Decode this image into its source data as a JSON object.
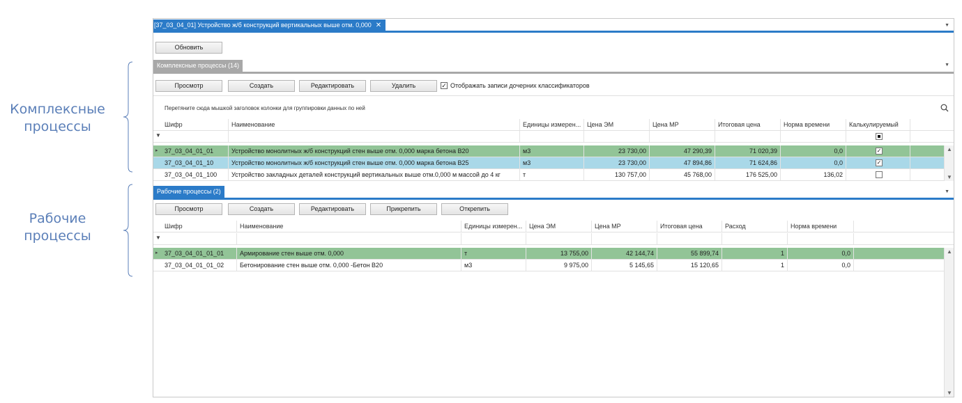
{
  "annotations": {
    "complex_line1": "Комплексные",
    "complex_line2": "процессы",
    "work_line1": "Рабочие",
    "work_line2": "процессы"
  },
  "doc_tab": {
    "title": "[37_03_04_01] Устройство ж/б конструкций вертикальных выше отм. 0,000",
    "close": "✕"
  },
  "refresh_button": "Обновить",
  "complex": {
    "tab_label": "Комплексные процессы (14)",
    "buttons": {
      "view": "Просмотр",
      "create": "Создать",
      "edit": "Редактировать",
      "delete": "Удалить"
    },
    "show_child_label": "Отображать записи дочерних классификаторов",
    "show_child_checked": "✓",
    "group_hint": "Перетяните сюда мышкой заголовок колонки для группировки данных по ней",
    "columns": [
      "Шифр",
      "Наименование",
      "Единицы измерен...",
      "Цена ЭМ",
      "Цена МР",
      "Итоговая цена",
      "Норма времени",
      "Калькулируемый"
    ],
    "rows": [
      {
        "code": "37_03_04_01_01",
        "name": "Устройство монолитных ж/б конструкций стен выше отм. 0,000 марка бетона В20",
        "unit": "м3",
        "em": "23 730,00",
        "mr": "47 290,39",
        "total": "71 020,39",
        "norm": "0,0",
        "calc": "✓"
      },
      {
        "code": "37_03_04_01_10",
        "name": "Устройство монолитных ж/б конструкций стен выше отм. 0,000 марка бетона В25",
        "unit": "м3",
        "em": "23 730,00",
        "mr": "47 894,86",
        "total": "71 624,86",
        "norm": "0,0",
        "calc": "✓"
      },
      {
        "code": "37_03_04_01_100",
        "name": "Устройство закладных деталей конструкций вертикальных выше отм.0,000 м массой до 4 кг",
        "unit": "т",
        "em": "130 757,00",
        "mr": "45 768,00",
        "total": "176 525,00",
        "norm": "136,02",
        "calc": ""
      }
    ]
  },
  "work": {
    "tab_label": "Рабочие процессы (2)",
    "buttons": {
      "view": "Просмотр",
      "create": "Создать",
      "edit": "Редактировать",
      "attach": "Прикрепить",
      "detach": "Открепить"
    },
    "columns": [
      "Шифр",
      "Наименование",
      "Единицы измерен...",
      "Цена ЭМ",
      "Цена МР",
      "Итоговая цена",
      "Расход",
      "Норма времени"
    ],
    "rows": [
      {
        "code": "37_03_04_01_01_01",
        "name": "Армирование стен выше отм. 0,000",
        "unit": "т",
        "em": "13 755,00",
        "mr": "42 144,74",
        "total": "55 899,74",
        "usage": "1",
        "norm": "0,0"
      },
      {
        "code": "37_03_04_01_01_02",
        "name": "Бетонирование стен выше отм. 0,000 -Бетон В20",
        "unit": "м3",
        "em": "9 975,00",
        "mr": "5 145,65",
        "total": "15 120,65",
        "usage": "1",
        "norm": "0,0"
      }
    ]
  },
  "icons": {
    "filter": "filter-icon",
    "search": "search-icon",
    "row_indicator": "row-indicator-icon"
  },
  "colors": {
    "accent": "#2b7bc8",
    "row_selected": "#92c497",
    "row_focused": "#a9d8e8",
    "annotation": "#5b7fb8",
    "inactive_tab": "#a8a8a8"
  }
}
